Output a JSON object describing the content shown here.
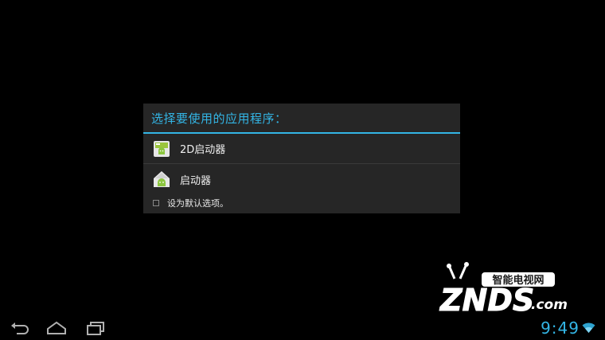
{
  "dialog": {
    "title": "选择要使用的应用程序：",
    "apps": [
      {
        "label": "2D启动器",
        "icon": "launcher-2d-icon"
      },
      {
        "label": "启动器",
        "icon": "launcher-home-icon"
      }
    ],
    "default_checkbox": {
      "label": "设为默认选项。",
      "checked": false
    }
  },
  "watermark": {
    "brand": "ZNDS",
    "tagline": "智能电视网",
    "domain": ".com"
  },
  "status": {
    "time": "9:49",
    "wifi_icon": "wifi-icon"
  },
  "nav": {
    "back_icon": "back-icon",
    "home_icon": "home-icon",
    "recents_icon": "recent-apps-icon"
  },
  "colors": {
    "accent": "#33b5e5",
    "dialog_bg": "#262626",
    "background": "#000000"
  }
}
